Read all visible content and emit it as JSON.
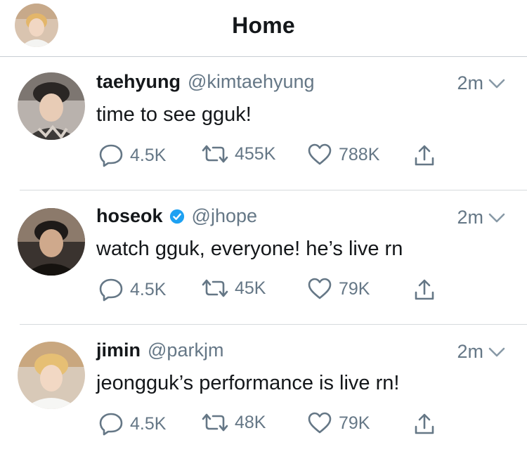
{
  "header": {
    "title": "Home"
  },
  "colors": {
    "accent": "#1da1f2",
    "secondary_text": "#657786",
    "divider": "#d6dadd"
  },
  "tweets": [
    {
      "name": "taehyung",
      "handle": "@kimtaehyung",
      "verified": false,
      "time": "2m",
      "text": "time to see gguk!",
      "replies": "4.5K",
      "retweets": "455K",
      "likes": "788K"
    },
    {
      "name": "hoseok",
      "handle": "@jhope",
      "verified": true,
      "time": "2m",
      "text": "watch gguk, everyone! he’s live rn",
      "replies": "4.5K",
      "retweets": "45K",
      "likes": "79K"
    },
    {
      "name": "jimin",
      "handle": "@parkjm",
      "verified": false,
      "time": "2m",
      "text": "jeongguk’s performance is live rn!",
      "replies": "4.5K",
      "retweets": "48K",
      "likes": "79K"
    }
  ]
}
